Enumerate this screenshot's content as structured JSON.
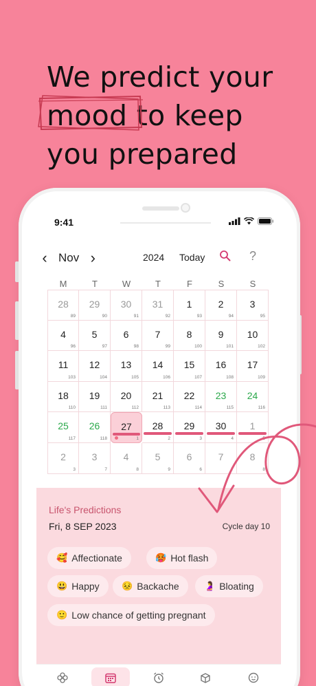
{
  "headline": {
    "line1": "We predict your",
    "line2_word": "mood",
    "line2_rest": "to keep",
    "line3": "you prepared"
  },
  "status": {
    "time": "9:41"
  },
  "calendar": {
    "month": "Nov",
    "year": "2024",
    "today_label": "Today",
    "help": "?",
    "weekdays": [
      "M",
      "T",
      "W",
      "T",
      "F",
      "S",
      "S"
    ],
    "days": [
      {
        "d": "28",
        "s": "89",
        "muted": true
      },
      {
        "d": "29",
        "s": "90",
        "muted": true
      },
      {
        "d": "30",
        "s": "91",
        "muted": true
      },
      {
        "d": "31",
        "s": "92",
        "muted": true
      },
      {
        "d": "1",
        "s": "93"
      },
      {
        "d": "2",
        "s": "94"
      },
      {
        "d": "3",
        "s": "95"
      },
      {
        "d": "4",
        "s": "96"
      },
      {
        "d": "5",
        "s": "97"
      },
      {
        "d": "6",
        "s": "98"
      },
      {
        "d": "7",
        "s": "99"
      },
      {
        "d": "8",
        "s": "100"
      },
      {
        "d": "9",
        "s": "101"
      },
      {
        "d": "10",
        "s": "102"
      },
      {
        "d": "11",
        "s": "103"
      },
      {
        "d": "12",
        "s": "104"
      },
      {
        "d": "13",
        "s": "105"
      },
      {
        "d": "14",
        "s": "106"
      },
      {
        "d": "15",
        "s": "107"
      },
      {
        "d": "16",
        "s": "108"
      },
      {
        "d": "17",
        "s": "109"
      },
      {
        "d": "18",
        "s": "110"
      },
      {
        "d": "19",
        "s": "111"
      },
      {
        "d": "20",
        "s": "112"
      },
      {
        "d": "21",
        "s": "113"
      },
      {
        "d": "22",
        "s": "114"
      },
      {
        "d": "23",
        "s": "115",
        "green": true
      },
      {
        "d": "24",
        "s": "116",
        "green": true
      },
      {
        "d": "25",
        "s": "117",
        "green": true
      },
      {
        "d": "26",
        "s": "118",
        "green": true
      },
      {
        "d": "27",
        "s": "1",
        "today": true,
        "period": true
      },
      {
        "d": "28",
        "s": "2",
        "period": true
      },
      {
        "d": "29",
        "s": "3",
        "period": true
      },
      {
        "d": "30",
        "s": "4",
        "period": true
      },
      {
        "d": "1",
        "s": "5",
        "muted": true,
        "period": true
      },
      {
        "d": "2",
        "s": "3",
        "muted": true
      },
      {
        "d": "3",
        "s": "7",
        "muted": true
      },
      {
        "d": "4",
        "s": "8",
        "muted": true
      },
      {
        "d": "5",
        "s": "9",
        "muted": true
      },
      {
        "d": "6",
        "s": "6",
        "muted": true
      },
      {
        "d": "7",
        "s": "7",
        "muted": true
      },
      {
        "d": "8",
        "s": "8",
        "muted": true
      }
    ]
  },
  "predictions": {
    "title": "Life's Predictions",
    "date": "Fri, 8 SEP 2023",
    "cycle": "Cycle day 10",
    "chips": [
      {
        "emoji": "🥰",
        "label": "Affectionate"
      },
      {
        "emoji": "🥵",
        "label": "Hot flash"
      },
      {
        "emoji": "😃",
        "label": "Happy"
      },
      {
        "emoji": "😣",
        "label": "Backache"
      },
      {
        "emoji": "🤰",
        "label": "Bloating"
      },
      {
        "emoji": "🙂",
        "label": "Low chance of getting pregnant"
      }
    ]
  },
  "tabs": [
    "flower-icon",
    "calendar-icon",
    "alarm-icon",
    "box-icon",
    "face-icon"
  ],
  "colors": {
    "background": "#f7839a",
    "accent": "#e0587a",
    "green": "#2aa84a",
    "panel": "#fbdadf"
  }
}
